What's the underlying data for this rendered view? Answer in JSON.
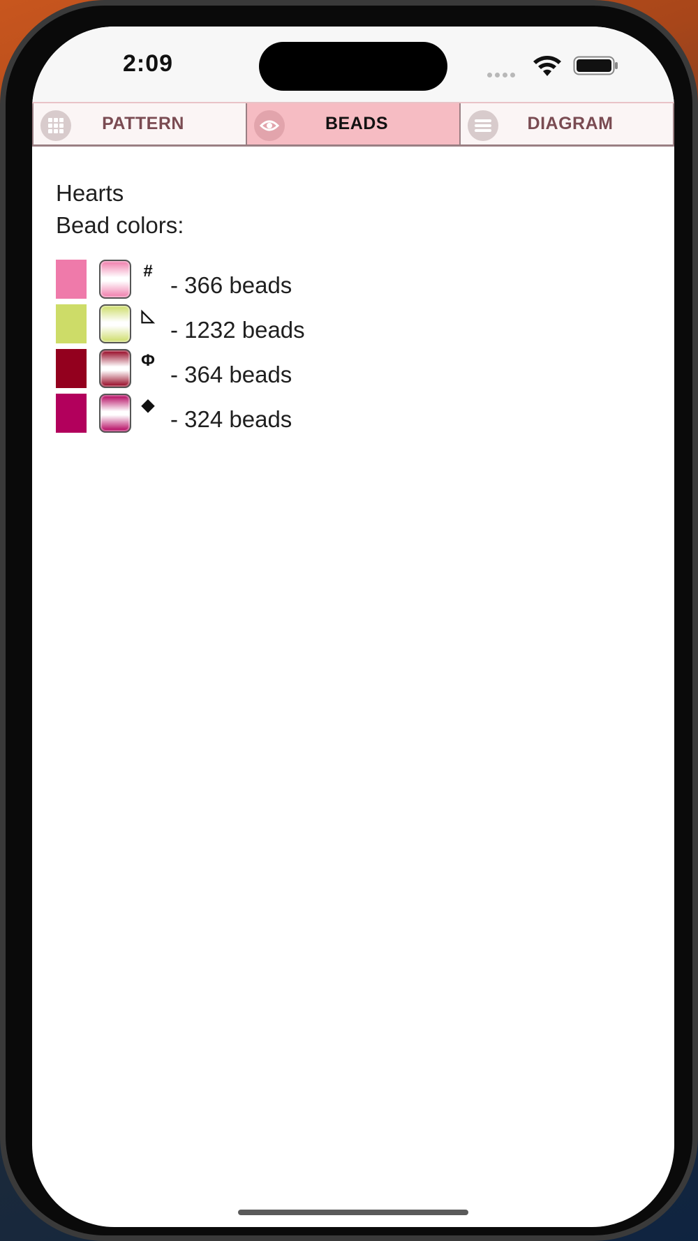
{
  "status_bar": {
    "time": "2:09"
  },
  "tabs": [
    {
      "label": "PATTERN",
      "icon": "grid-icon",
      "active": false
    },
    {
      "label": "BEADS",
      "icon": "eye-icon",
      "active": true
    },
    {
      "label": "DIAGRAM",
      "icon": "list-icon",
      "active": false
    }
  ],
  "content": {
    "pattern_name": "Hearts",
    "colors_heading": "Bead colors:",
    "beads": [
      {
        "color": "#ef7aaa",
        "symbol": "#",
        "count_text": "- 366 beads"
      },
      {
        "color": "#cddc68",
        "symbol": "◺",
        "count_text": "- 1232 beads"
      },
      {
        "color": "#93001e",
        "symbol": "Φ",
        "count_text": "- 364 beads"
      },
      {
        "color": "#b2005c",
        "symbol": "◆",
        "count_text": "- 324 beads"
      }
    ]
  },
  "colors": {
    "active_tab": "#f6bcc3",
    "tab_text": "#7a4b52"
  }
}
